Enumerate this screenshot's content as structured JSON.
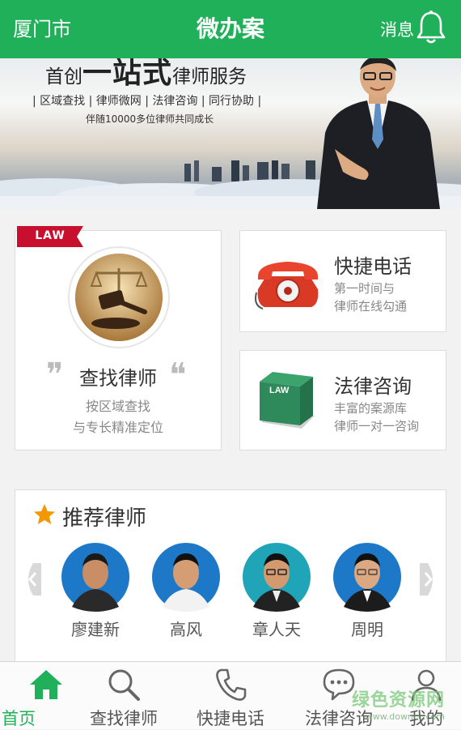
{
  "topbar": {
    "city": "厦门市",
    "title": "微办案",
    "message_label": "消息",
    "bell_icon": "bell-icon"
  },
  "banner": {
    "slogan_pre": "首创",
    "slogan_big": "一站式",
    "slogan_post": "律师服务",
    "features": "| 区域查找 | 律师微网 | 法律咨询 | 同行协助 |",
    "tagline": "伴随10000多位律师共同成长"
  },
  "find_card": {
    "ribbon": "LAW",
    "title": "查找律师",
    "desc_line1": "按区域查找",
    "desc_line2": "与专长精准定位",
    "icon": "gavel-icon"
  },
  "phone_card": {
    "title": "快捷电话",
    "desc_line1": "第一时间与",
    "desc_line2": "律师在线勾通",
    "icon": "telephone-icon"
  },
  "consult_card": {
    "title": "法律咨询",
    "desc_line1": "丰富的案源库",
    "desc_line2": "律师一对一咨询",
    "book_label": "LAW",
    "icon": "law-book-icon"
  },
  "recommend": {
    "title": "推荐律师",
    "lawyers": [
      {
        "name": "廖建新"
      },
      {
        "name": "高风"
      },
      {
        "name": "章人天"
      },
      {
        "name": "周明"
      }
    ]
  },
  "nav": {
    "items": [
      {
        "label": "首页",
        "icon": "home-icon",
        "active": true
      },
      {
        "label": "查找律师",
        "icon": "search-icon",
        "active": false
      },
      {
        "label": "快捷电话",
        "icon": "phone-icon",
        "active": false
      },
      {
        "label": "法律咨询",
        "icon": "chat-icon",
        "active": false
      },
      {
        "label": "我的",
        "icon": "user-icon",
        "active": false
      }
    ]
  },
  "watermark": {
    "line1": "绿色资源网",
    "line2": "www.downcc.com"
  },
  "colors": {
    "brand_green": "#21b05a",
    "ribbon_red": "#c8102e",
    "star_orange": "#f39800"
  }
}
